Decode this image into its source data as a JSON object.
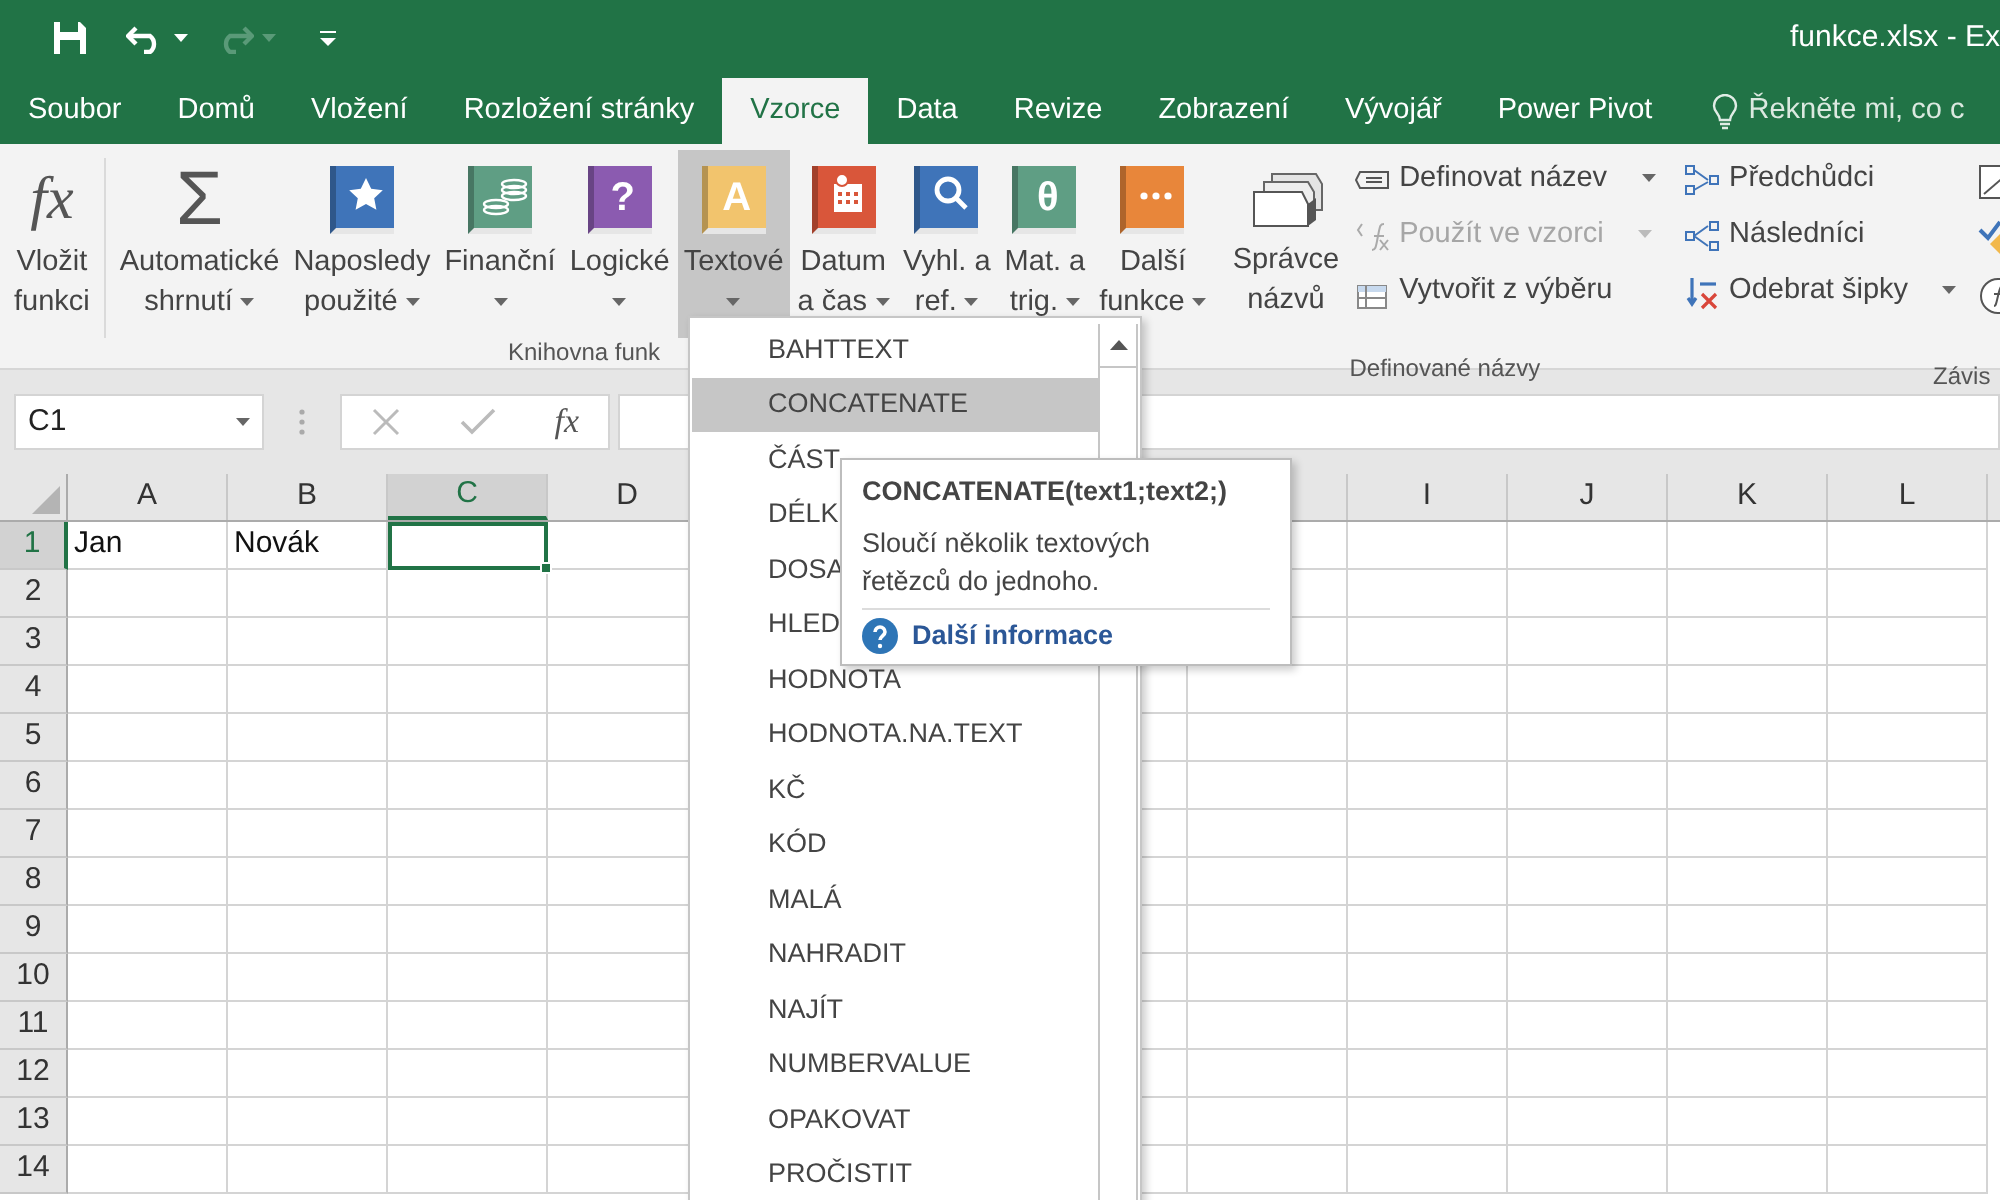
{
  "window": {
    "title": "funkce.xlsx - Ex"
  },
  "tabs": [
    {
      "label": "Soubor",
      "selected": false
    },
    {
      "label": "Domů",
      "selected": false
    },
    {
      "label": "Vložení",
      "selected": false
    },
    {
      "label": "Rozložení stránky",
      "selected": false
    },
    {
      "label": "Vzorce",
      "selected": true
    },
    {
      "label": "Data",
      "selected": false
    },
    {
      "label": "Revize",
      "selected": false
    },
    {
      "label": "Zobrazení",
      "selected": false
    },
    {
      "label": "Vývojář",
      "selected": false
    },
    {
      "label": "Power Pivot",
      "selected": false
    }
  ],
  "tell_me": "Řekněte mi, co c",
  "ribbon": {
    "library": {
      "label": "Knihovna funk",
      "buttons": [
        {
          "lines": [
            "Vložit",
            "funkci"
          ],
          "glyph": "fx",
          "dropdown": false,
          "selected": false
        },
        {
          "lines": [
            "Automatické",
            "shrnutí"
          ],
          "glyph": "Σ",
          "dropdown": true,
          "selected": false
        },
        {
          "lines": [
            "Naposledy",
            "použité"
          ],
          "dropdown": true,
          "selected": false
        },
        {
          "lines": [
            "Finanční"
          ],
          "dropdown": true,
          "selected": false
        },
        {
          "lines": [
            "Logické"
          ],
          "glyph": "?",
          "dropdown": true,
          "selected": false
        },
        {
          "lines": [
            "Textové"
          ],
          "glyph": "A",
          "dropdown": true,
          "selected": true
        },
        {
          "lines": [
            "Datum",
            "a čas"
          ],
          "dropdown": true,
          "selected": false
        },
        {
          "lines": [
            "Vyhl. a",
            "ref."
          ],
          "dropdown": true,
          "selected": false
        },
        {
          "lines": [
            "Mat. a",
            "trig."
          ],
          "glyph": "θ",
          "dropdown": true,
          "selected": false
        },
        {
          "lines": [
            "Další",
            "funkce"
          ],
          "dropdown": true,
          "selected": false
        }
      ]
    },
    "names": {
      "label": "Definované názvy",
      "big": {
        "lines": [
          "Správce",
          "názvů"
        ]
      },
      "buttons": [
        {
          "label": "Definovat název",
          "dropdown": true,
          "disabled": false
        },
        {
          "label": "Použít ve vzorci",
          "dropdown": true,
          "disabled": true
        },
        {
          "label": "Vytvořit z výběru",
          "dropdown": false,
          "disabled": false
        }
      ]
    },
    "auditing": {
      "label": "Závis",
      "buttons": [
        {
          "label": "Předchůdci",
          "dropdown": false
        },
        {
          "label": "Následníci",
          "dropdown": false
        },
        {
          "label": "Odebrat šipky",
          "dropdown": true
        }
      ]
    }
  },
  "formula_bar": {
    "name_box": "C1",
    "function_glyph": "fx"
  },
  "columns": [
    {
      "label": "A",
      "selected": false
    },
    {
      "label": "B",
      "selected": false
    },
    {
      "label": "C",
      "selected": true
    },
    {
      "label": "D",
      "selected": false
    }
  ],
  "columns_right": [
    {
      "label": "I",
      "selected": false
    },
    {
      "label": "J",
      "selected": false
    },
    {
      "label": "K",
      "selected": false
    },
    {
      "label": "L",
      "selected": false
    }
  ],
  "rows": [
    {
      "label": "1",
      "selected": true,
      "cells": [
        {
          "text": "Jan",
          "active": false
        },
        {
          "text": "Novák",
          "active": false
        },
        {
          "active": true
        }
      ]
    },
    {
      "label": "2",
      "selected": false
    },
    {
      "label": "3",
      "selected": false
    },
    {
      "label": "4",
      "selected": false
    },
    {
      "label": "5",
      "selected": false
    },
    {
      "label": "6",
      "selected": false
    },
    {
      "label": "7",
      "selected": false
    },
    {
      "label": "8",
      "selected": false
    },
    {
      "label": "9",
      "selected": false
    },
    {
      "label": "10",
      "selected": false
    },
    {
      "label": "11",
      "selected": false
    },
    {
      "label": "12",
      "selected": false
    },
    {
      "label": "13",
      "selected": false
    },
    {
      "label": "14",
      "selected": false
    }
  ],
  "function_menu": {
    "items": [
      {
        "label": "BAHTTEXT",
        "selected": false
      },
      {
        "label": "CONCATENATE",
        "selected": true
      },
      {
        "label": "ČÁST",
        "selected": false
      },
      {
        "label": "DÉLK",
        "selected": false
      },
      {
        "label": "DOSA",
        "selected": false
      },
      {
        "label": "HLED",
        "selected": false
      },
      {
        "label": "HODNOTA",
        "selected": false
      },
      {
        "label": "HODNOTA.NA.TEXT",
        "selected": false
      },
      {
        "label": "KČ",
        "selected": false
      },
      {
        "label": "KÓD",
        "selected": false
      },
      {
        "label": "MALÁ",
        "selected": false
      },
      {
        "label": "NAHRADIT",
        "selected": false
      },
      {
        "label": "NAJÍT",
        "selected": false
      },
      {
        "label": "NUMBERVALUE",
        "selected": false
      },
      {
        "label": "OPAKOVAT",
        "selected": false
      },
      {
        "label": "PROČISTIT",
        "selected": false
      }
    ]
  },
  "tooltip": {
    "title": "CONCATENATE(text1;text2;)",
    "description": "Sloučí několik textových řetězců do jednoho.",
    "link": "Další informace"
  }
}
